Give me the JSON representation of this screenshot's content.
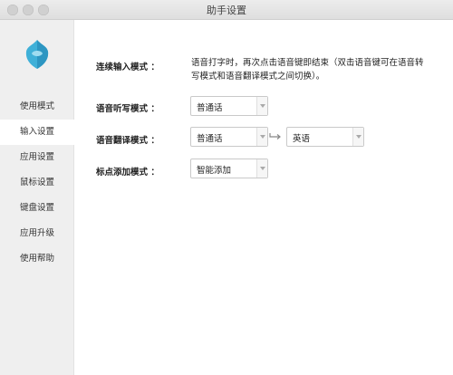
{
  "window": {
    "title": "助手设置"
  },
  "sidebar": {
    "logo_icon": "shield-logo-icon",
    "items": [
      {
        "label": "使用模式",
        "active": false
      },
      {
        "label": "输入设置",
        "active": true
      },
      {
        "label": "应用设置",
        "active": false
      },
      {
        "label": "鼠标设置",
        "active": false
      },
      {
        "label": "键盘设置",
        "active": false
      },
      {
        "label": "应用升级",
        "active": false
      },
      {
        "label": "使用帮助",
        "active": false
      }
    ]
  },
  "settings": {
    "continuous_input": {
      "label": "连续输入模式",
      "description": "语音打字时，再次点击语音键即结束（双击语音键可在语音转写模式和语音翻译模式之间切换）。"
    },
    "dictation": {
      "label": "语音听写模式",
      "value": "普通话"
    },
    "translation": {
      "label": "语音翻译模式",
      "from_value": "普通话",
      "to_value": "英语",
      "swap_icon": "swap-arrow-icon"
    },
    "punctuation": {
      "label": "标点添加模式",
      "value": "智能添加"
    }
  },
  "colors": {
    "sidebar_bg": "#efefef",
    "logo_blue": "#3fb0d8",
    "active_item_bg": "#ffffff"
  }
}
